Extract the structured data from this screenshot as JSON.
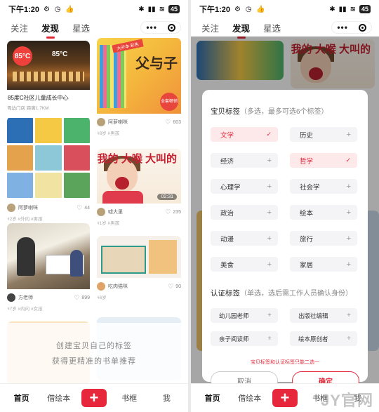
{
  "status": {
    "time": "下午1:20",
    "battery": "45"
  },
  "nav": {
    "tabs": [
      "关注",
      "发现",
      "星选"
    ],
    "active": "发现"
  },
  "feed": {
    "store": {
      "title": "85度C社区儿童成长中心",
      "sub": "周边门店  距离1.7KM",
      "logo": "85°C"
    },
    "books_post": {
      "user": "阿萝喇咪",
      "likes": "44",
      "tags": "#2岁  #外向  #男孩"
    },
    "teacher_post": {
      "user": "方老师",
      "likes": "899",
      "tags": "#7岁  #内向  #女孩"
    },
    "dad_post": {
      "user": "阿萝喇咪",
      "likes": "603",
      "tags": "#8岁  #男孩",
      "book_title": "父与子",
      "ribbon": "大开本 彩色",
      "sticker": "全套畅销"
    },
    "noise_post": {
      "user": "嘘大里",
      "likes": "235",
      "tags": "#1岁  #男孩",
      "words": "我的 大喉 大叫的",
      "duration": "02:31"
    },
    "gift_post": {
      "user": "吃肉猫咪",
      "likes": "90",
      "tags": "#6岁"
    }
  },
  "promo": {
    "line1": "创建宝贝自己的标签",
    "line2": "获得更精准的书单推荐"
  },
  "tabbar": {
    "home": "首页",
    "borrow": "借绘本",
    "plus": "+",
    "shelf": "书框",
    "me": "我"
  },
  "sheet": {
    "baby_title": "宝贝标签",
    "baby_hint": "（多选，最多可选6个标签）",
    "tags": [
      {
        "label": "文学",
        "selected": true
      },
      {
        "label": "历史",
        "selected": false
      },
      {
        "label": "经济",
        "selected": false
      },
      {
        "label": "哲学",
        "selected": true
      },
      {
        "label": "心理学",
        "selected": false
      },
      {
        "label": "社会学",
        "selected": false
      },
      {
        "label": "政治",
        "selected": false
      },
      {
        "label": "绘本",
        "selected": false
      },
      {
        "label": "动漫",
        "selected": false
      },
      {
        "label": "旅行",
        "selected": false
      },
      {
        "label": "美食",
        "selected": false
      },
      {
        "label": "家居",
        "selected": false
      }
    ],
    "cert_title": "认证标签",
    "cert_hint": "（单选，选后需工作人员确认身份）",
    "certs": [
      "幼儿园老师",
      "出版社编辑",
      "亲子阅读师",
      "绘本原创者"
    ],
    "warning": "宝贝标签和认证标签只能二选一",
    "cancel": "取消",
    "confirm": "确定"
  },
  "watermark": "JY官网",
  "colors": {
    "accent": "#e02a3c",
    "selected_bg": "#fde8ea"
  }
}
